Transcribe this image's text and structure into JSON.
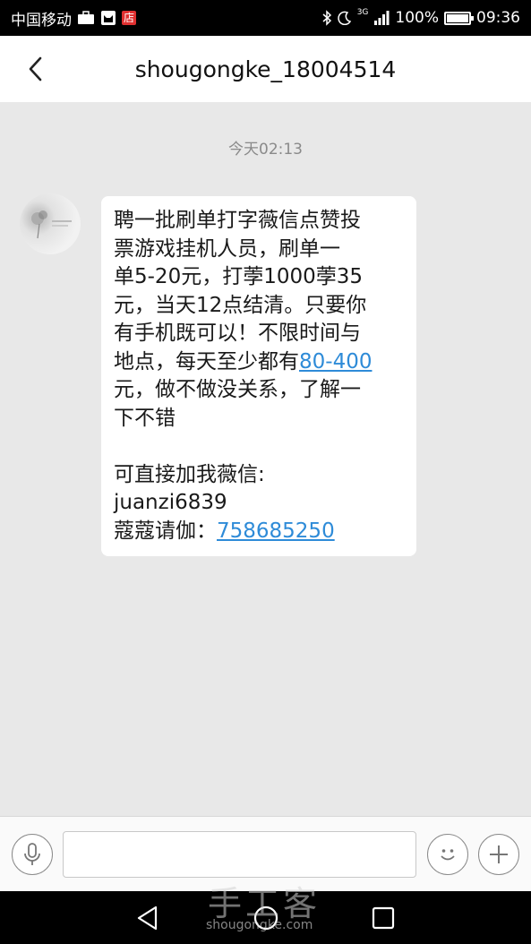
{
  "status_bar": {
    "carrier": "中国移动",
    "shop_badge": "店",
    "network": "3G",
    "battery": "100%",
    "battery_level": 1.0,
    "time": "09:36"
  },
  "header": {
    "contact": "shougongke_18004514"
  },
  "conversation": {
    "timestamp": "今天02:13",
    "message": {
      "lines": [
        "聘一批刷单打字薇信点赞投",
        "票游戏挂机人员，刷单一",
        "单5-20元，打荸1000荸35",
        "元，当天12点结清。只要你",
        "有手机既可以！不限时间与"
      ],
      "line6_prefix": "地点，每天至少都有",
      "line6_link": "80-400",
      "line7": "元，做不做没关系，了解一",
      "line8": "下不错",
      "line9": "可直接加我薇信:",
      "line10": "juanzi6839",
      "line11_prefix": "蔻蔻请伽：",
      "line11_link": "758685250"
    }
  },
  "input_bar": {
    "placeholder": ""
  },
  "watermark": {
    "main": "手工客",
    "sub": "shougongke.com"
  }
}
